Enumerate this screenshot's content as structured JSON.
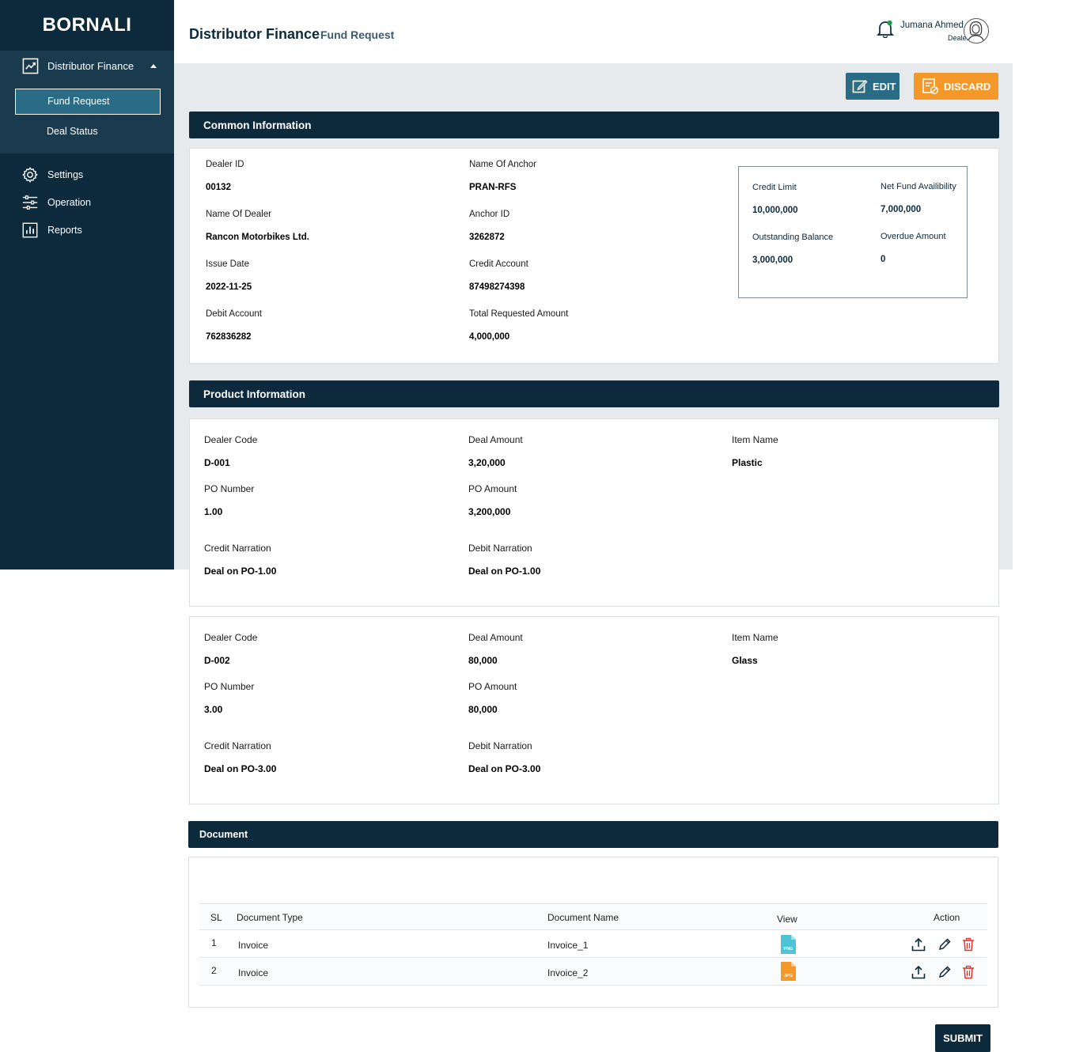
{
  "brand": "BORNALI",
  "sidebar": {
    "group_label": "Distributor Finance",
    "sub_items": [
      "Fund Request",
      "Deal Status"
    ],
    "items": [
      "Settings",
      "Operation",
      "Reports"
    ]
  },
  "header": {
    "title": "Distributor Finance",
    "subtitle": "Fund Request",
    "user_name": "Jumana Ahmed",
    "user_role": "Dealer"
  },
  "toolbar": {
    "edit_label": "EDIT",
    "discard_label": "DISCARD"
  },
  "common": {
    "title": "Common Information",
    "fields": {
      "dealer_id": {
        "label": "Dealer ID",
        "value": "00132"
      },
      "name_of_anchor": {
        "label": "Name Of Anchor",
        "value": "PRAN-RFS"
      },
      "name_of_dealer": {
        "label": "Name Of Dealer",
        "value": "Rancon Motorbikes Ltd."
      },
      "anchor_id": {
        "label": "Anchor ID",
        "value": "3262872"
      },
      "issue_date": {
        "label": "Issue Date",
        "value": "2022-11-25"
      },
      "credit_account": {
        "label": "Credit Account",
        "value": "87498274398"
      },
      "debit_account": {
        "label": "Debit Account",
        "value": "762836282"
      },
      "total_requested": {
        "label": "Total Requested Amount",
        "value": "4,000,000"
      }
    },
    "fund": {
      "credit_limit": {
        "label": "Credit Limit",
        "value": "10,000,000"
      },
      "net_fund": {
        "label": "Net Fund Availibility",
        "value": "7,000,000"
      },
      "outstanding": {
        "label": "Outstanding Balance",
        "value": "3,000,000"
      },
      "overdue": {
        "label": "Overdue Amount",
        "value": "0"
      }
    }
  },
  "product": {
    "title": "Product Information",
    "labels": {
      "dealer_code": "Dealer Code",
      "deal_amount": "Deal Amount",
      "item_name": "Item Name",
      "po_number": "PO Number",
      "po_amount": "PO Amount",
      "credit_narration": "Credit Narration",
      "debit_narration": "Debit Narration"
    },
    "items": [
      {
        "dealer_code": "D-001",
        "deal_amount": "3,20,000",
        "item_name": "Plastic",
        "po_number": "1.00",
        "po_amount": "3,200,000",
        "credit_narration": "Deal on PO-1.00",
        "debit_narration": "Deal on PO-1.00"
      },
      {
        "dealer_code": "D-002",
        "deal_amount": "80,000",
        "item_name": "Glass",
        "po_number": "3.00",
        "po_amount": "80,000",
        "credit_narration": "Deal on PO-3.00",
        "debit_narration": "Deal on PO-3.00"
      }
    ]
  },
  "document": {
    "title": "Document",
    "columns": [
      "SL",
      "Document Type",
      "Document Name",
      "View",
      "Action"
    ],
    "rows": [
      {
        "sl": "1",
        "type": "Invoice",
        "name": "Invoice_1",
        "file_badge": "PNG",
        "file_color": "#4cc3d6"
      },
      {
        "sl": "2",
        "type": "Invoice",
        "name": "Invoice_2",
        "file_badge": "JPG",
        "file_color": "#f5982a"
      }
    ]
  },
  "submit_label": "SUBMIT",
  "colors": {
    "navy": "#0d2a3d",
    "teal": "#2a6b85",
    "orange": "#f5982a",
    "delete_red": "#e0342f"
  }
}
